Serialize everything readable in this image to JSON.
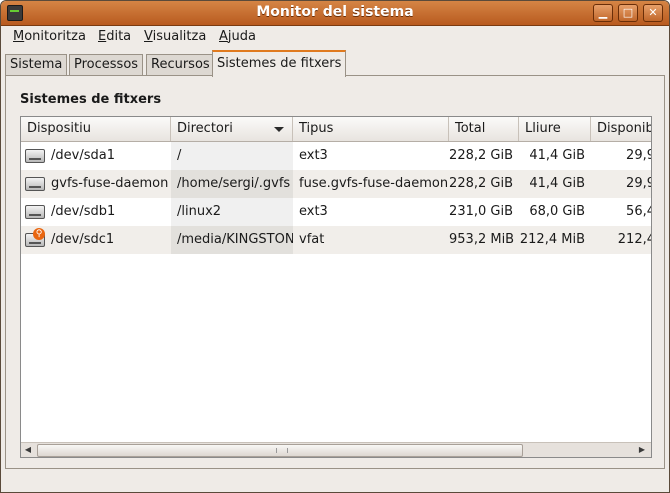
{
  "window": {
    "title": "Monitor del sistema"
  },
  "menubar": [
    {
      "label": "Monitoritza",
      "mnemonic": "M",
      "rest": "onitoritza"
    },
    {
      "label": "Edita",
      "mnemonic": "E",
      "rest": "dita"
    },
    {
      "label": "Visualitza",
      "mnemonic": "V",
      "rest": "isualitza"
    },
    {
      "label": "Ajuda",
      "mnemonic": "A",
      "rest": "juda"
    }
  ],
  "tabs": [
    {
      "label": "Sistema",
      "active": false
    },
    {
      "label": "Processos",
      "active": false
    },
    {
      "label": "Recursos",
      "active": false
    },
    {
      "label": "Sistemes de fitxers",
      "active": true
    }
  ],
  "panel": {
    "title": "Sistemes de fitxers",
    "columns": [
      "Dispositiu",
      "Directori",
      "Tipus",
      "Total",
      "Lliure",
      "Disponible"
    ],
    "sort_column": "Directori",
    "rows": [
      {
        "device": "/dev/sda1",
        "icon": "hard-drive-icon",
        "directory": "/",
        "type": "ext3",
        "total": "228,2 GiB",
        "free": "41,4 GiB",
        "available": "29,9"
      },
      {
        "device": "gvfs-fuse-daemon",
        "icon": "hard-drive-icon",
        "directory": "/home/sergi/.gvfs",
        "type": "fuse.gvfs-fuse-daemon",
        "total": "228,2 GiB",
        "free": "41,4 GiB",
        "available": "29,9"
      },
      {
        "device": "/dev/sdb1",
        "icon": "hard-drive-icon",
        "directory": "/linux2",
        "type": "ext3",
        "total": "231,0 GiB",
        "free": "68,0 GiB",
        "available": "56,4"
      },
      {
        "device": "/dev/sdc1",
        "icon": "usb-drive-icon",
        "directory": "/media/KINGSTON",
        "type": "vfat",
        "total": "953,2 MiB",
        "free": "212,4 MiB",
        "available": "212,4"
      }
    ],
    "scrollbar": {
      "left_arrow": "◀",
      "right_arrow": "▶"
    }
  }
}
